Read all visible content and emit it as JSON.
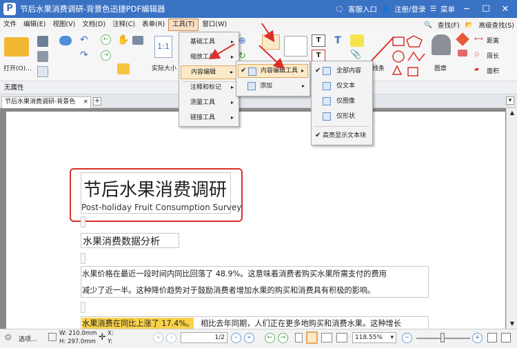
{
  "title_bar": {
    "logo": "P",
    "title": "节后水果消费调研-背景色迅捷PDF编辑器",
    "support": "客服入口",
    "login": "注册/登录",
    "menu": "菜单"
  },
  "menu_bar": {
    "items": [
      "文件",
      "编辑(E)",
      "视图(V)",
      "文档(D)",
      "注释(C)",
      "表单(R)",
      "工具(T)",
      "窗口(W)"
    ],
    "search": "查找(F)",
    "advanced_search": "高级查找(S)"
  },
  "ribbon": {
    "open_label": "打开(O)...",
    "actual_size_label": "实际大小",
    "line_label": "线条",
    "stamp_label": "图章",
    "distance_label": "距离",
    "perimeter_label": "周长",
    "area_label": "面积",
    "page_number_glyph": "1:1"
  },
  "properties": {
    "label": "无属性"
  },
  "tabs": {
    "doc_tab": "节后水果消费调研-背景色",
    "close": "×",
    "new": "+"
  },
  "tools_menu": {
    "items": [
      "基础工具",
      "缩放工具",
      "内容编辑",
      "注释和标记",
      "测量工具",
      "链接工具"
    ],
    "highlighted": "内容编辑"
  },
  "content_edit_menu": {
    "items": [
      "内容编辑工具",
      "添加"
    ],
    "highlighted": "内容编辑工具"
  },
  "edit_tools_menu": {
    "items": [
      "全部内容",
      "仅文本",
      "仅图像",
      "仅形状"
    ],
    "footer": "高亮显示文本块"
  },
  "document": {
    "title": "节后水果消费调研",
    "subtitle": "Post-holiday Fruit Consumption Survey",
    "section": "水果消费数据分析",
    "para1_line1": "水果价格在最近一段时间内同比回落了  48.9%。这意味着消费者购买水果所需支付的费用",
    "para1_line2": "减少了近一半。这种降价趋势对于鼓励消费者增加水果的购买和消费具有积极的影响。",
    "para2_highlight": "水果消费在同比上涨了 17.4%。",
    "para2_rest": "相比去年同期，人们正在更多地购买和消费水果。这种增长"
  },
  "status_bar": {
    "select_mode": "选项...",
    "width": "W: 210.0mm",
    "height": "H: 297.0mm",
    "x": "X:",
    "y": "Y:",
    "page_value": "1",
    "page_total": "/2",
    "zoom": "118.55%"
  },
  "colors": {
    "title_bar": "#3a72c4",
    "menu_highlight": "#f7dfc4",
    "red_outline": "#d9302a",
    "text_highlight": "#f9d24b"
  }
}
